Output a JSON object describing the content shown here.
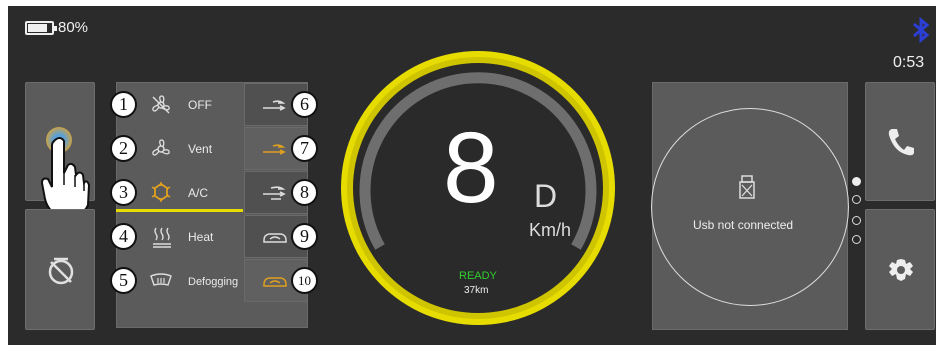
{
  "status": {
    "battery": "80%",
    "time": "0:53",
    "bluetooth_icon": "bluetooth-icon"
  },
  "climate_menu": {
    "items": [
      {
        "number": "1",
        "label": "OFF",
        "icon": "fan-off-icon"
      },
      {
        "number": "2",
        "label": "Vent",
        "icon": "fan-icon"
      },
      {
        "number": "3",
        "label": "A/C",
        "icon": "ac-snowflake-icon"
      },
      {
        "number": "4",
        "label": "Heat",
        "icon": "heat-waves-icon"
      },
      {
        "number": "5",
        "label": "Defogging",
        "icon": "defog-windshield-icon"
      }
    ],
    "airflow": [
      {
        "number": "6",
        "icon": "airflow-icon"
      },
      {
        "number": "7",
        "icon": "airflow-icon"
      },
      {
        "number": "8",
        "icon": "airflow-mixed-icon"
      },
      {
        "number": "9",
        "icon": "car-recirculate-icon"
      },
      {
        "number": "10",
        "icon": "car-recirculate-icon"
      }
    ]
  },
  "speedometer": {
    "speed": "8",
    "gear": "D",
    "unit": "Km/h",
    "status": "READY",
    "range": "37km"
  },
  "media": {
    "usb_status": "Usb not connected",
    "icon": "usb-icon"
  },
  "colors": {
    "accent_yellow": "#e6dc00",
    "active_orange": "#e0a020",
    "ready_green": "#2fd02f",
    "bluetooth_blue": "#2b3fd6"
  }
}
